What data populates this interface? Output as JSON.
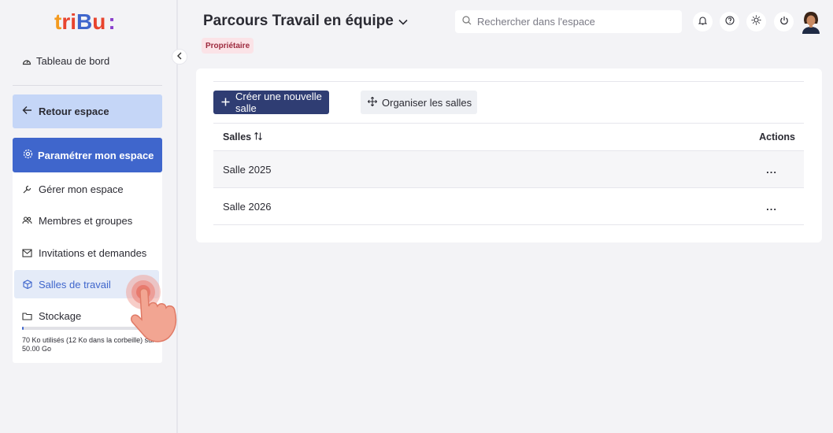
{
  "brand": {
    "logo_text": "tribu:"
  },
  "sidebar": {
    "dashboard": "Tableau de bord",
    "back": "Retour espace",
    "configure": "Paramétrer mon espace",
    "items": [
      {
        "label": "Gérer mon espace",
        "icon": "wrench-icon"
      },
      {
        "label": "Membres et groupes",
        "icon": "users-icon"
      },
      {
        "label": "Invitations et demandes",
        "icon": "mail-icon"
      },
      {
        "label": "Salles de travail",
        "icon": "cube-icon",
        "active": true
      },
      {
        "label": "Stockage",
        "icon": "folder-icon"
      }
    ],
    "storage_text": "70 Ko utilisés (12 Ko dans la corbeille) sur 50.00 Go",
    "storage_used_fraction": 1.4e-06
  },
  "header": {
    "title": "Parcours Travail en équipe",
    "role_badge": "Propriétaire",
    "search_placeholder": "Rechercher dans l'espace"
  },
  "toolbar": {
    "create_label": "Créer une nouvelle salle",
    "organize_label": "Organiser les salles"
  },
  "table": {
    "col_name": "Salles",
    "col_actions": "Actions",
    "rows": [
      {
        "name": "Salle 2025",
        "actions": "..."
      },
      {
        "name": "Salle 2026",
        "actions": "..."
      }
    ]
  },
  "colors": {
    "primary": "#3f66cc",
    "dark_button": "#2f3d73",
    "badge_bg": "#fbe3e7",
    "badge_text": "#9d2a3e"
  }
}
